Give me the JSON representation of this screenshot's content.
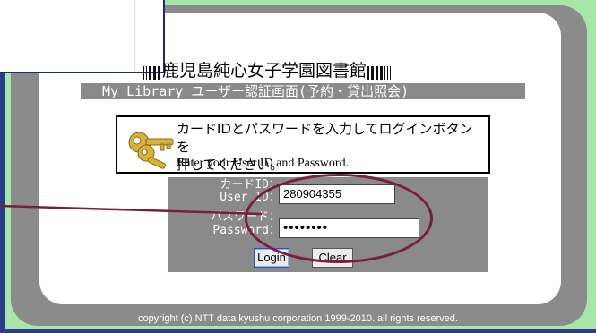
{
  "header": {
    "library_title": "鹿児島純心女子学園図書館",
    "subtitle": "My Library ユーザー認証画面(予約・貸出照会)"
  },
  "instructions": {
    "line1": "カードIDとパスワードを入力してログインボタンを",
    "line2": "押してください。",
    "english": "Enter your User ID and Password."
  },
  "form": {
    "card_id_label_jp": "カードID：",
    "card_id_label_en": "User ID：",
    "card_id_value": "280904355",
    "password_label_jp": "パスワード：",
    "password_label_en": "Password：",
    "password_value": "••••••••",
    "login_label": "Login",
    "clear_label": "Clear"
  },
  "footer": {
    "copyright": "copyright (c) NTT data kyushu corporation 1999-2010. all rights reserved."
  },
  "colors": {
    "frame_green": "#a6e6a6",
    "panel_gray": "#8a8a8a",
    "highlight": "#7a1f3a",
    "edge_blue": "#2a3c8a"
  }
}
